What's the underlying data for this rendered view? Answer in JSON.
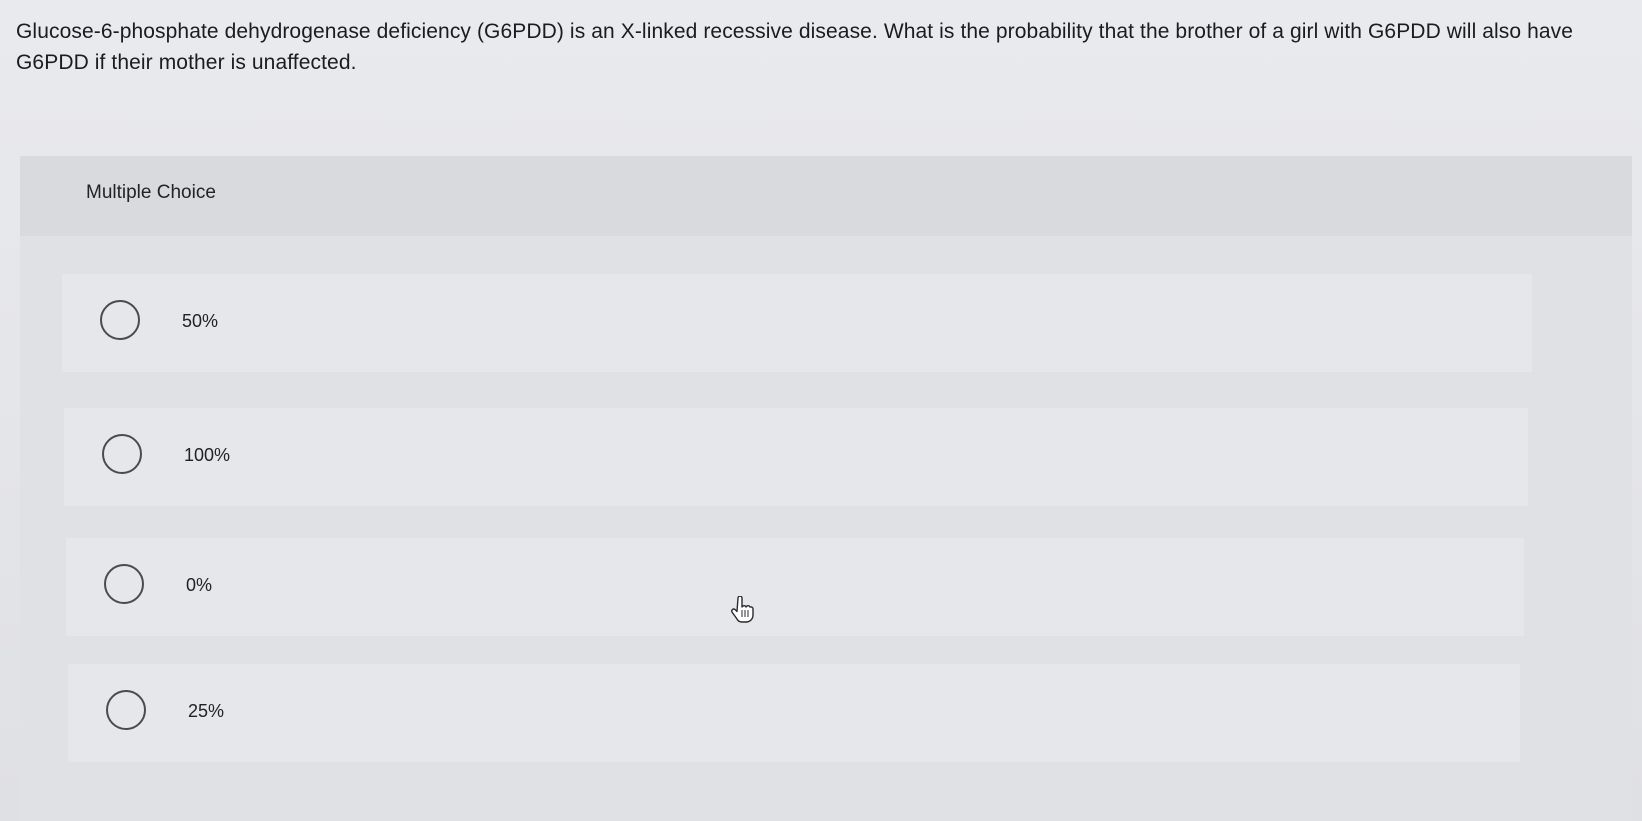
{
  "question": {
    "text": "Glucose-6-phosphate dehydrogenase deficiency (G6PDD) is an X-linked recessive disease. What is the probability that the brother of a girl with G6PDD will also have G6PDD if their mother is unaffected."
  },
  "panel": {
    "title": "Multiple Choice"
  },
  "options": [
    {
      "label": "50%",
      "selected": false
    },
    {
      "label": "100%",
      "selected": false
    },
    {
      "label": "0%",
      "selected": false
    },
    {
      "label": "25%",
      "selected": false
    }
  ],
  "cursor": {
    "icon": "pointer-hand-icon"
  }
}
